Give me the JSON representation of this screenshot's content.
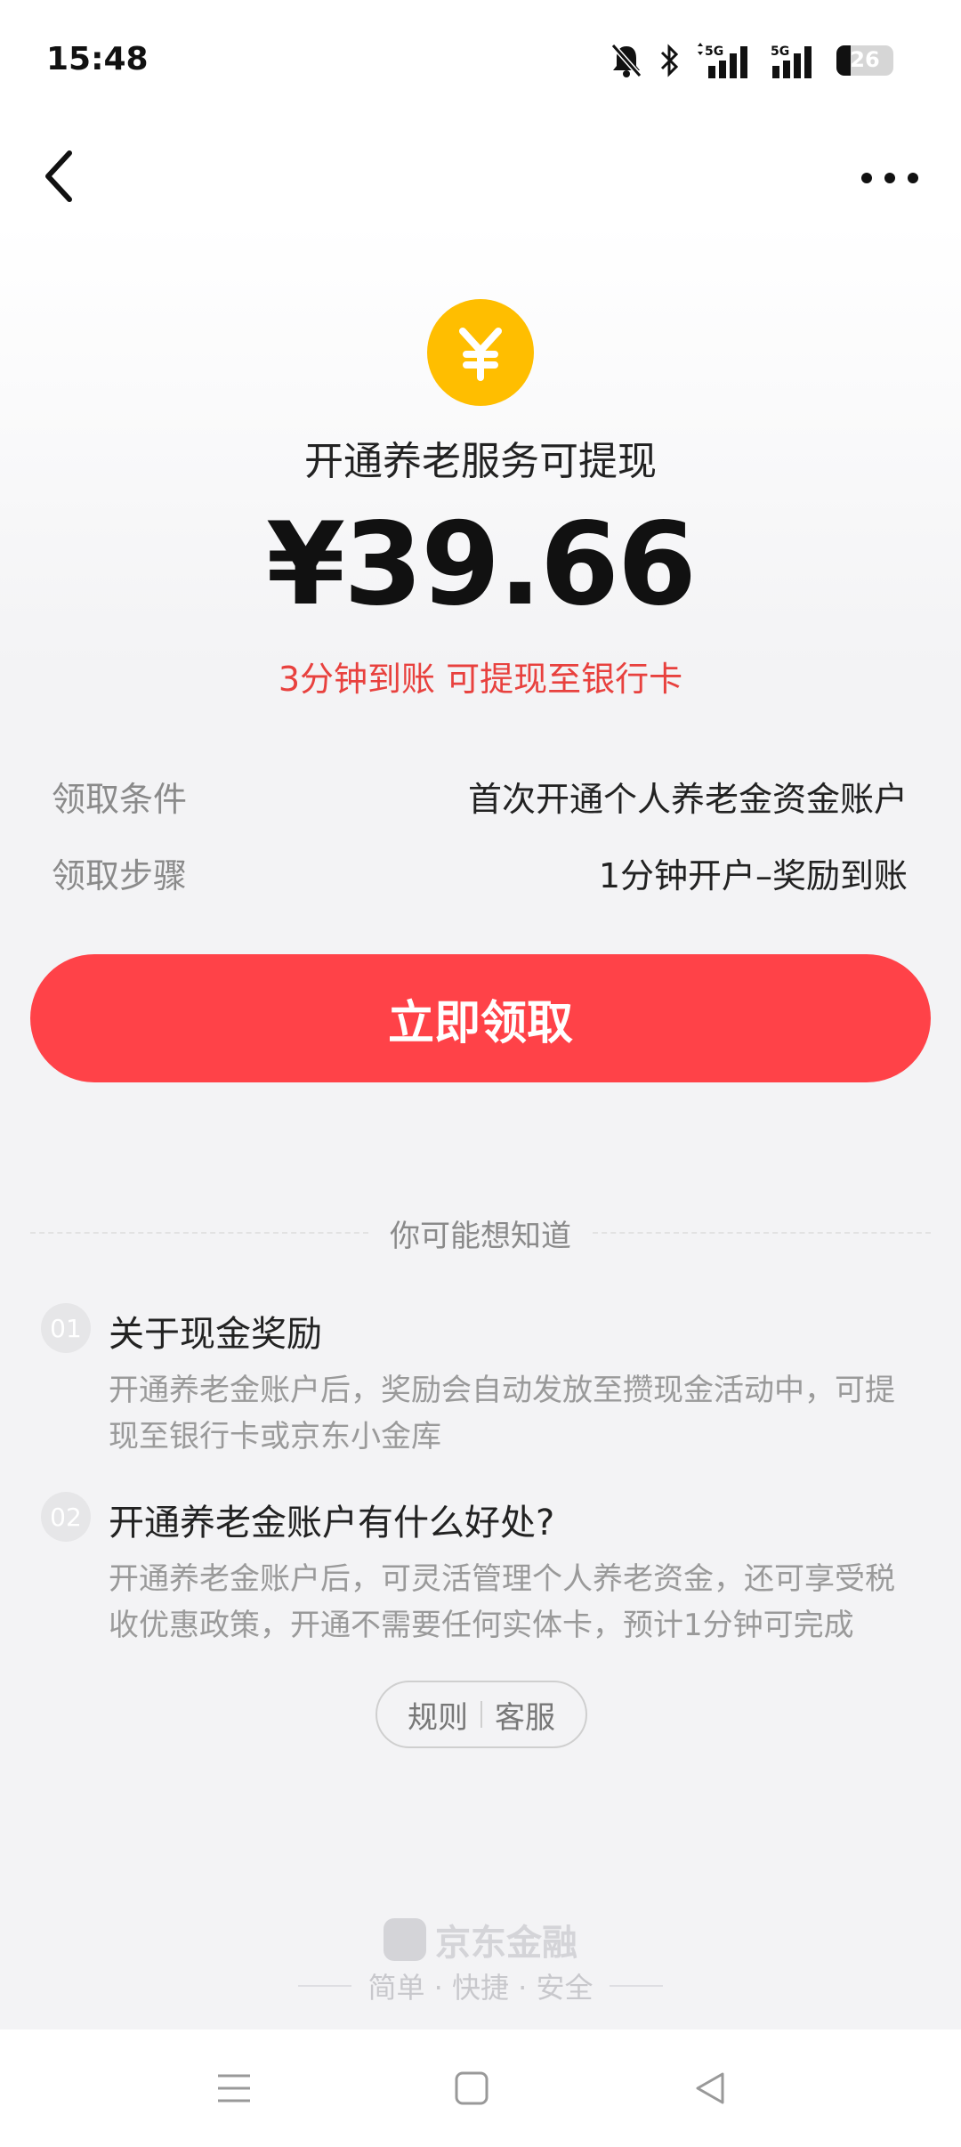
{
  "status_bar": {
    "time": "15:48",
    "battery": "26",
    "icons": [
      "mute-icon",
      "bluetooth-icon",
      "signal-5g-icon",
      "signal-5g-icon",
      "battery-icon"
    ]
  },
  "nav": {
    "back_icon": "chevron-left-icon",
    "more_icon": "more-dots-icon"
  },
  "hero": {
    "coin_symbol": "¥",
    "title": "开通养老服务可提现",
    "amount": "¥39.66",
    "subtitle": "3分钟到账 可提现至银行卡"
  },
  "info": [
    {
      "label": "领取条件",
      "value": "首次开通个人养老金资金账户"
    },
    {
      "label": "领取步骤",
      "value": "1分钟开户–奖励到账"
    }
  ],
  "claim_button": "立即领取",
  "faq": {
    "heading": "你可能想知道",
    "items": [
      {
        "num": "01",
        "question": "关于现金奖励",
        "answer_line1": "开通养老金账户后，奖励会自动发放至攒现金活动中，可提",
        "answer_line2": "现至银行卡或京东小金库"
      },
      {
        "num": "02",
        "question": "开通养老金账户有什么好处?",
        "answer_line1": "开通养老金账户后，可灵活管理个人养老资金，还可享受税",
        "answer_line2": "收优惠政策，开通不需要任何实体卡，预计1分钟可完成"
      }
    ]
  },
  "links": {
    "rules": "规则",
    "service": "客服"
  },
  "footer": {
    "brand": "京东金融",
    "slogan": "简单 · 快捷 · 安全"
  },
  "colors": {
    "accent": "#ff4248",
    "coin": "#ffbe00",
    "subtitle": "#e8413e"
  }
}
